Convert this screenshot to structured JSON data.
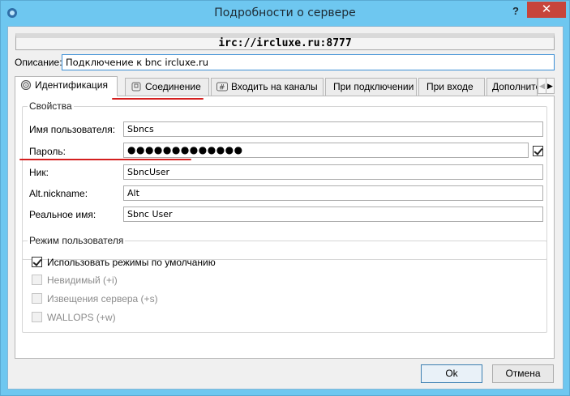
{
  "window": {
    "title": "Подробности о сервере",
    "help_label": "?",
    "close_label": "✕"
  },
  "server": {
    "address": "irc://ircluxe.ru:8777"
  },
  "description": {
    "label": "Описание:",
    "value": "Подключение к bnc ircluxe.ru"
  },
  "tabs": [
    {
      "label": "Идентификация",
      "icon": "fingerprint-icon",
      "active": true
    },
    {
      "label": "Соединение",
      "icon": "plug-icon",
      "active": false
    },
    {
      "label": "Входить на каналы",
      "icon": "hash-channel-icon",
      "active": false
    },
    {
      "label": "При подключении",
      "active": false
    },
    {
      "label": "При входе",
      "active": false
    },
    {
      "label": "Дополните",
      "active": false
    }
  ],
  "properties": {
    "group_title": "Свойства",
    "username_label": "Имя пользователя:",
    "username_value": "Sbncs",
    "password_label": "Пароль:",
    "password_value": "●●●●●●●●●●●●●",
    "password_show_checked": true,
    "nick_label": "Ник:",
    "nick_value": "SbncUser",
    "altnick_label": "Alt.nickname:",
    "altnick_value": "Alt",
    "realname_label": "Реальное имя:",
    "realname_value": "Sbnc User"
  },
  "user_mode": {
    "group_title": "Режим пользователя",
    "options": [
      {
        "label": "Использовать режимы по умолчанию",
        "checked": true,
        "enabled": true
      },
      {
        "label": "Невидимый (+i)",
        "checked": false,
        "enabled": false
      },
      {
        "label": "Извещения сервера (+s)",
        "checked": false,
        "enabled": false
      },
      {
        "label": "WALLOPS (+w)",
        "checked": false,
        "enabled": false
      }
    ]
  },
  "buttons": {
    "ok_label": "Ok",
    "cancel_label": "Отмена"
  },
  "colors": {
    "titlebar": "#6ec7f0",
    "close_button": "#c7443b",
    "annotation_red": "#d41f1f"
  }
}
